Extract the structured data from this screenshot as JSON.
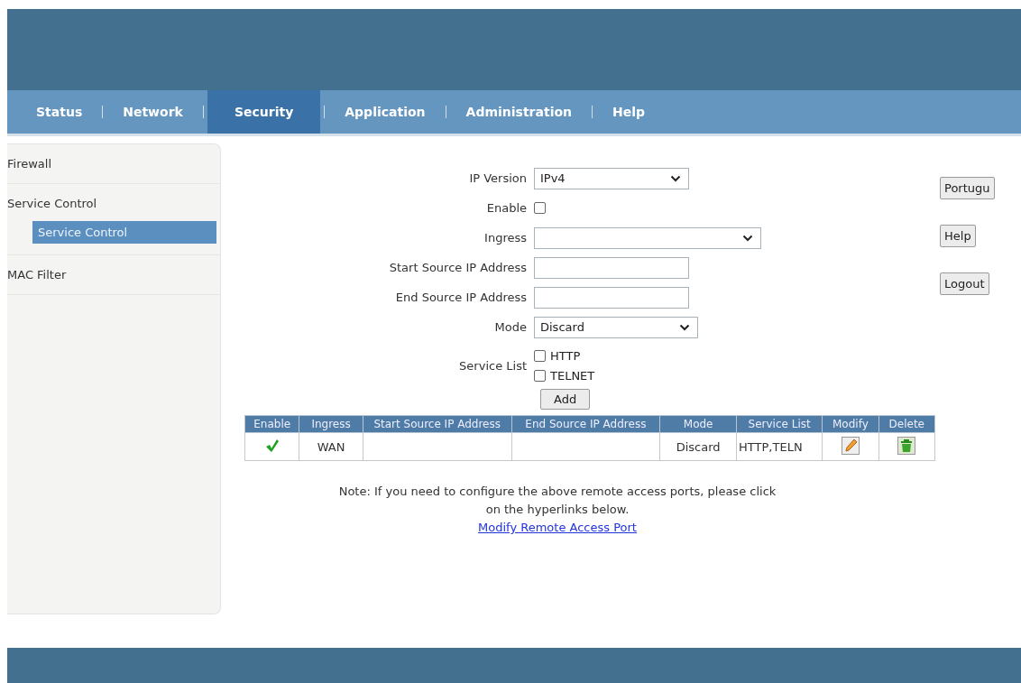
{
  "nav": {
    "tabs": [
      {
        "label": "Status",
        "selected": false
      },
      {
        "label": "Network",
        "selected": false
      },
      {
        "label": "Security",
        "selected": true
      },
      {
        "label": "Application",
        "selected": false
      },
      {
        "label": "Administration",
        "selected": false
      },
      {
        "label": "Help",
        "selected": false
      }
    ]
  },
  "sidebar": {
    "items": [
      {
        "label": "Firewall",
        "selected": false
      },
      {
        "label": "Service Control",
        "selected": false,
        "children": [
          {
            "label": "Service Control",
            "selected": true
          }
        ]
      },
      {
        "label": "MAC Filter",
        "selected": false
      }
    ]
  },
  "form": {
    "fields": [
      {
        "kind": "select",
        "label": "IP Version",
        "value": "IPv4"
      },
      {
        "kind": "checkbox",
        "label": "Enable",
        "checked": false
      },
      {
        "kind": "select",
        "label": "Ingress"
      },
      {
        "kind": "text",
        "label": "Start Source IP Address"
      },
      {
        "kind": "text",
        "label": "End Source IP Address"
      },
      {
        "kind": "select",
        "label": "Mode",
        "value": "Discard"
      },
      {
        "kind": "checklist",
        "label": "Service List",
        "options": [
          {
            "label": "HTTP",
            "checked": false
          },
          {
            "label": "TELNET",
            "checked": false
          }
        ]
      }
    ],
    "add_button": "Add"
  },
  "table": {
    "columns": [
      "Enable",
      "Ingress",
      "Start Source IP Address",
      "End Source IP Address",
      "Mode",
      "Service List",
      "Modify",
      "Delete"
    ],
    "rows": [
      {
        "enabled": true,
        "ingress": "WAN",
        "mode": "Discard",
        "service_list": "HTTP,TELN"
      }
    ]
  },
  "note": {
    "text": "Note: If you need to configure the above remote access ports, please click on the hyperlinks below.",
    "link": "Modify Remote Access Port"
  },
  "side_buttons": [
    "Portugu",
    "Help",
    "Logout"
  ]
}
